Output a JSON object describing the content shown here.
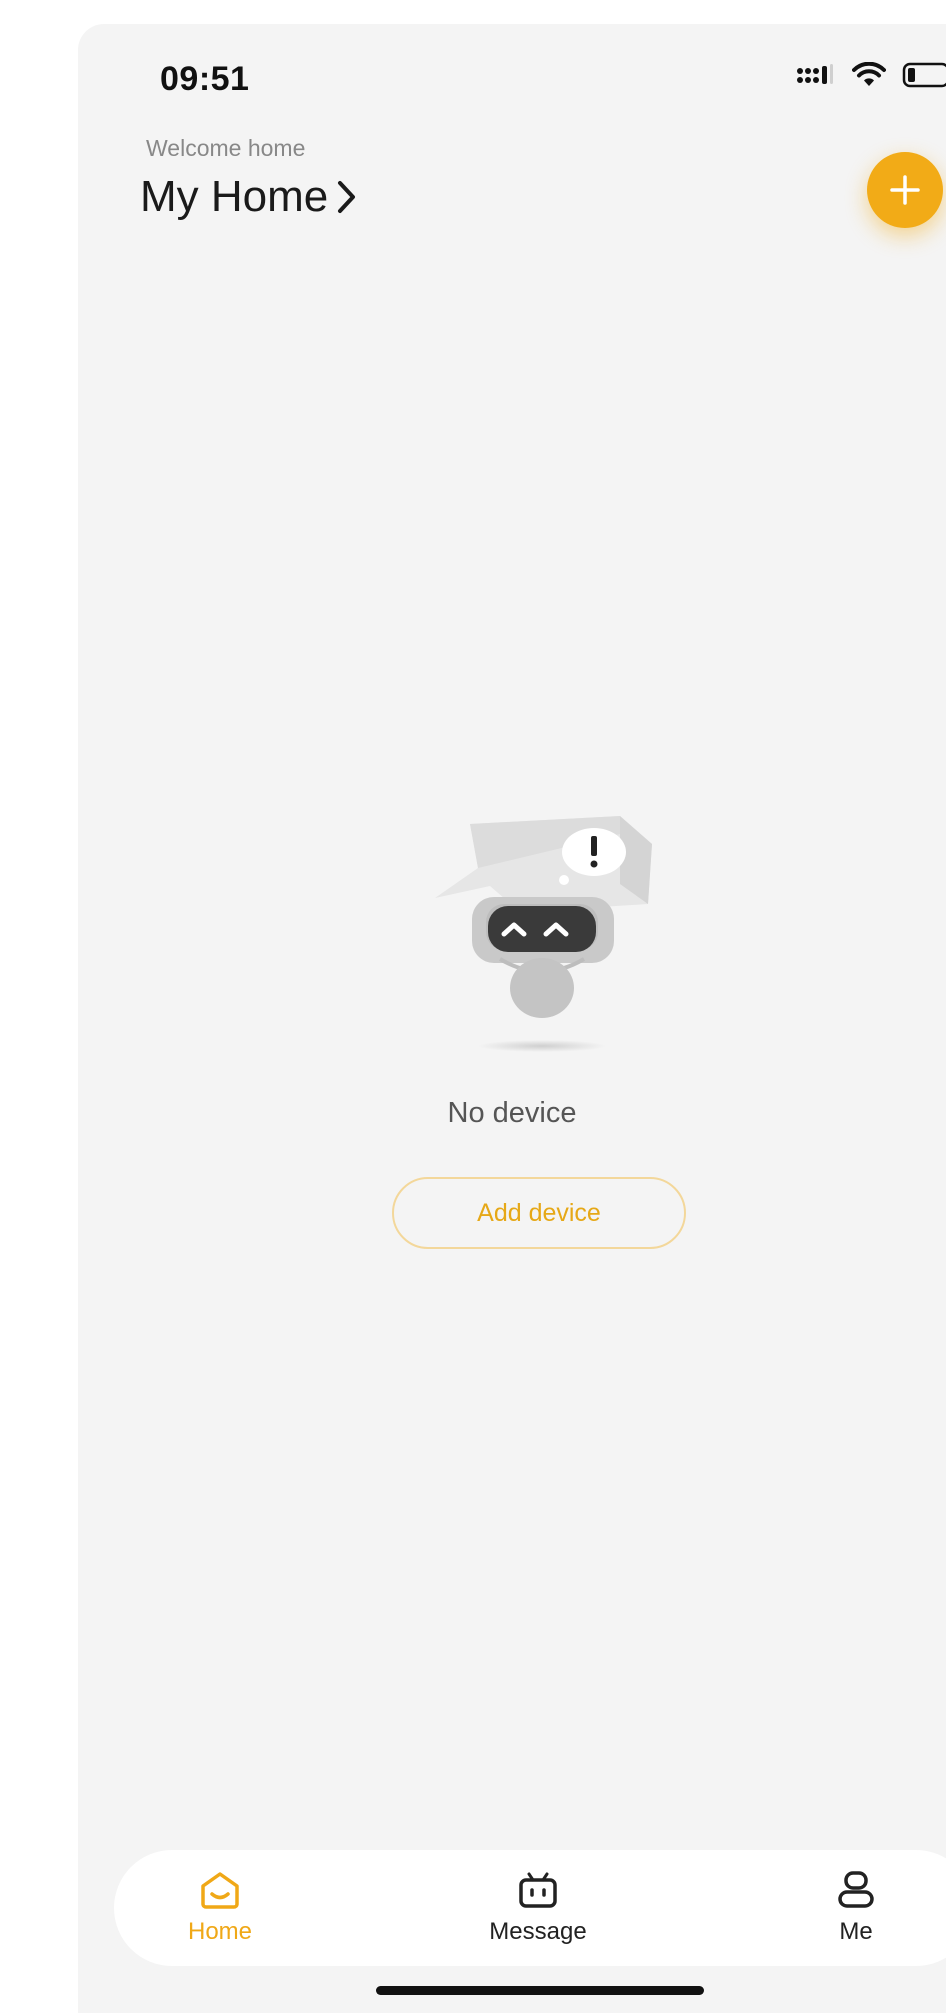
{
  "status_bar": {
    "time": "09:51",
    "icons": [
      "cellular-signal-icon",
      "wifi-icon",
      "battery-icon"
    ]
  },
  "header": {
    "welcome": "Welcome home",
    "home_name": "My Home",
    "chevron": "chevron-right-icon",
    "add_button_icon": "plus-icon"
  },
  "empty_state": {
    "illustration": "robot-box-icon",
    "message": "No device",
    "add_device_label": "Add device"
  },
  "bottom_nav": {
    "items": [
      {
        "label": "Home",
        "icon": "home-icon",
        "active": true
      },
      {
        "label": "Message",
        "icon": "message-icon",
        "active": false
      },
      {
        "label": "Me",
        "icon": "user-icon",
        "active": false
      }
    ]
  },
  "colors": {
    "accent": "#f2ab17",
    "background": "#f4f4f4",
    "button_border": "#f3d79a"
  }
}
